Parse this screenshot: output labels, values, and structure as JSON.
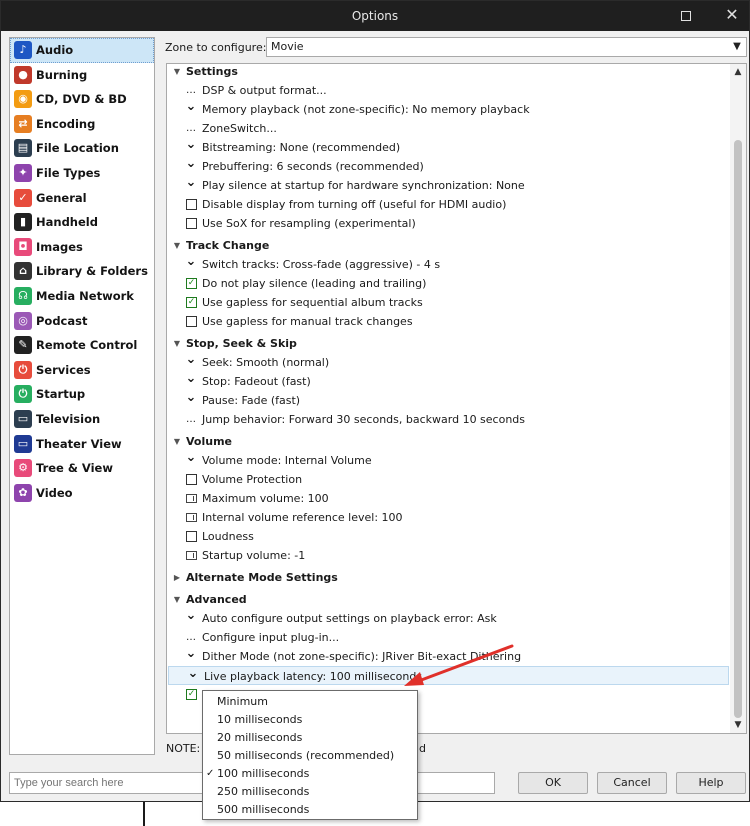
{
  "window": {
    "title": "Options"
  },
  "sidebar": {
    "items": [
      {
        "label": "Audio",
        "icon": "music-note-icon",
        "color": "#1d57c4",
        "glyph": "♪",
        "selected": true
      },
      {
        "label": "Burning",
        "icon": "burning-disc-icon",
        "color": "#c0392b",
        "glyph": "●"
      },
      {
        "label": "CD, DVD & BD",
        "icon": "disc-icon",
        "color": "#f39c12",
        "glyph": "◉"
      },
      {
        "label": "Encoding",
        "icon": "encoding-icon",
        "color": "#e67e22",
        "glyph": "⇄"
      },
      {
        "label": "File Location",
        "icon": "file-location-icon",
        "color": "#2c3e50",
        "glyph": "▤"
      },
      {
        "label": "File Types",
        "icon": "file-types-icon",
        "color": "#8e44ad",
        "glyph": "✦"
      },
      {
        "label": "General",
        "icon": "general-check-icon",
        "color": "#e74c3c",
        "glyph": "✓"
      },
      {
        "label": "Handheld",
        "icon": "handheld-icon",
        "color": "#222222",
        "glyph": "▮"
      },
      {
        "label": "Images",
        "icon": "camera-icon",
        "color": "#e84a7a",
        "glyph": "◘"
      },
      {
        "label": "Library & Folders",
        "icon": "library-icon",
        "color": "#333333",
        "glyph": "⌂"
      },
      {
        "label": "Media Network",
        "icon": "network-icon",
        "color": "#27ae60",
        "glyph": "☊"
      },
      {
        "label": "Podcast",
        "icon": "podcast-icon",
        "color": "#9b59b6",
        "glyph": "◎"
      },
      {
        "label": "Remote Control",
        "icon": "remote-control-icon",
        "color": "#222222",
        "glyph": "✎"
      },
      {
        "label": "Services",
        "icon": "services-plug-icon",
        "color": "#e74c3c",
        "glyph": "⏻"
      },
      {
        "label": "Startup",
        "icon": "power-icon",
        "color": "#27ae60",
        "glyph": "⏻"
      },
      {
        "label": "Television",
        "icon": "television-icon",
        "color": "#2c3e50",
        "glyph": "▭"
      },
      {
        "label": "Theater View",
        "icon": "theater-view-icon",
        "color": "#1f3a93",
        "glyph": "▭"
      },
      {
        "label": "Tree & View",
        "icon": "tree-view-gear-icon",
        "color": "#e84a7a",
        "glyph": "⚙"
      },
      {
        "label": "Video",
        "icon": "video-icon",
        "color": "#8e44ad",
        "glyph": "✿"
      }
    ]
  },
  "zone": {
    "label": "Zone to configure:",
    "value": "Movie"
  },
  "tree": {
    "rows": [
      {
        "kind": "header",
        "text": "Settings"
      },
      {
        "kind": "ellipsis",
        "text": "DSP & output format..."
      },
      {
        "kind": "chevron",
        "text": "Memory playback (not zone-specific): No memory playback"
      },
      {
        "kind": "ellipsis",
        "text": "ZoneSwitch..."
      },
      {
        "kind": "chevron",
        "text": "Bitstreaming: None (recommended)"
      },
      {
        "kind": "chevron",
        "text": "Prebuffering: 6 seconds (recommended)"
      },
      {
        "kind": "chevron",
        "text": "Play silence at startup for hardware synchronization: None"
      },
      {
        "kind": "checkbox",
        "checked": false,
        "text": "Disable display from turning off (useful for HDMI audio)"
      },
      {
        "kind": "checkbox",
        "checked": false,
        "text": "Use SoX for resampling (experimental)"
      },
      {
        "kind": "header",
        "text": "Track Change"
      },
      {
        "kind": "chevron",
        "text": "Switch tracks: Cross-fade (aggressive) - 4 s"
      },
      {
        "kind": "checkbox",
        "checked": true,
        "text": "Do not play silence (leading and trailing)"
      },
      {
        "kind": "checkbox",
        "checked": true,
        "text": "Use gapless for sequential album tracks"
      },
      {
        "kind": "checkbox",
        "checked": false,
        "text": "Use gapless for manual track changes"
      },
      {
        "kind": "header",
        "text": "Stop, Seek & Skip"
      },
      {
        "kind": "chevron",
        "text": "Seek: Smooth (normal)"
      },
      {
        "kind": "chevron",
        "text": "Stop: Fadeout (fast)"
      },
      {
        "kind": "chevron",
        "text": "Pause: Fade (fast)"
      },
      {
        "kind": "ellipsis",
        "text": "Jump behavior: Forward 30 seconds, backward 10 seconds"
      },
      {
        "kind": "header",
        "text": "Volume"
      },
      {
        "kind": "chevron",
        "text": "Volume mode: Internal Volume"
      },
      {
        "kind": "checkbox",
        "checked": false,
        "text": "Volume Protection"
      },
      {
        "kind": "number",
        "text": "Maximum volume: 100"
      },
      {
        "kind": "number",
        "text": "Internal volume reference level: 100"
      },
      {
        "kind": "checkbox",
        "checked": false,
        "text": "Loudness"
      },
      {
        "kind": "number",
        "text": "Startup volume: -1"
      },
      {
        "kind": "header-collapsed",
        "text": "Alternate Mode Settings"
      },
      {
        "kind": "header",
        "text": "Advanced"
      },
      {
        "kind": "chevron",
        "text": "Auto configure output settings on playback error: Ask"
      },
      {
        "kind": "ellipsis",
        "text": "Configure input plug-in..."
      },
      {
        "kind": "chevron",
        "text": "Dither Mode (not zone-specific): JRiver Bit-exact Dithering"
      },
      {
        "kind": "chevron",
        "highlight": true,
        "text": "Live playback latency: 100 milliseconds"
      },
      {
        "kind": "checkbox",
        "checked": true,
        "text": ""
      }
    ]
  },
  "note": {
    "prefix": "NOTE: C",
    "suffix": "d"
  },
  "dropdown": {
    "options": [
      {
        "label": "Minimum",
        "selected": false
      },
      {
        "label": "10 milliseconds",
        "selected": false
      },
      {
        "label": "20 milliseconds",
        "selected": false
      },
      {
        "label": "50 milliseconds (recommended)",
        "selected": false
      },
      {
        "label": "100 milliseconds",
        "selected": true
      },
      {
        "label": "250 milliseconds",
        "selected": false
      },
      {
        "label": "500 milliseconds",
        "selected": false
      }
    ]
  },
  "search": {
    "placeholder": "Type your search here"
  },
  "buttons": {
    "ok": "OK",
    "cancel": "Cancel",
    "help": "Help"
  },
  "colors": {
    "annotation_arrow": "#e0302a",
    "selection": "#cde6f7"
  }
}
